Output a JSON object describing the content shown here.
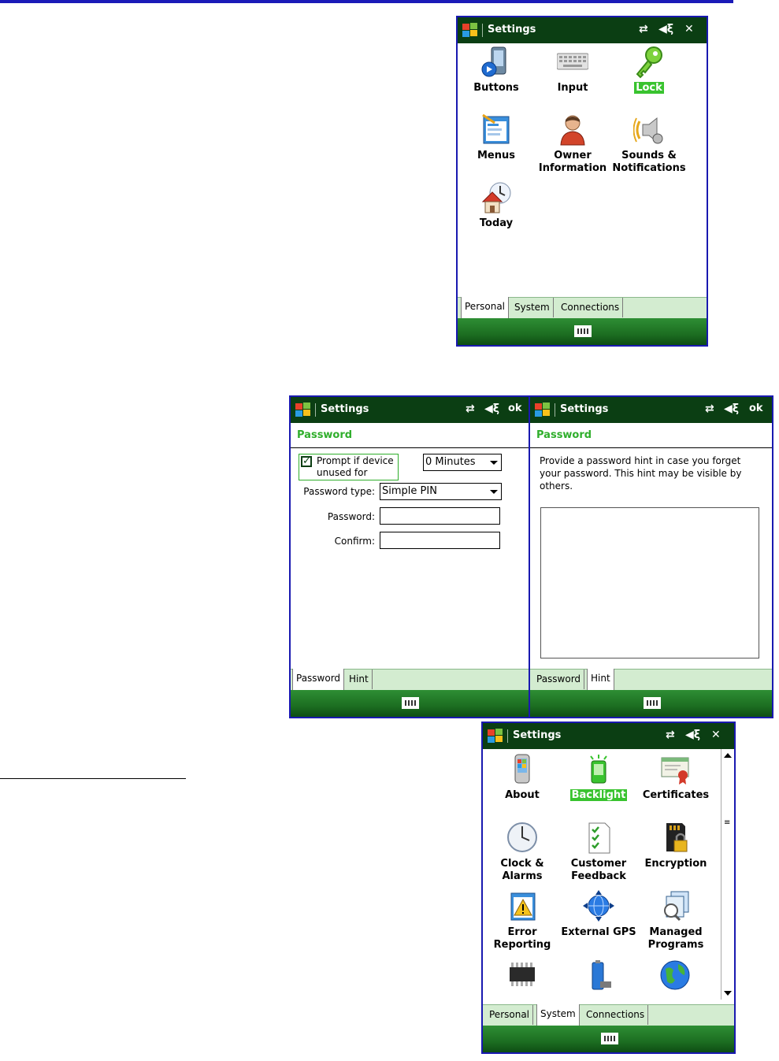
{
  "screen1": {
    "title": "Settings",
    "close_glyph": "✕",
    "icons": [
      {
        "label": "Buttons",
        "icon": "buttons-icon"
      },
      {
        "label": "Input",
        "icon": "keyboard-icon"
      },
      {
        "label": "Lock",
        "icon": "key-icon",
        "highlighted": true
      },
      {
        "label": "Menus",
        "icon": "menus-icon"
      },
      {
        "label": "Owner Information",
        "icon": "owner-icon"
      },
      {
        "label": "Sounds & Notifications",
        "icon": "sounds-icon"
      },
      {
        "label": "Today",
        "icon": "today-icon"
      }
    ],
    "tabs": [
      "Personal",
      "System",
      "Connections"
    ],
    "selected_tab": "Personal"
  },
  "screen2": {
    "title": "Settings",
    "ok_label": "ok",
    "header": "Password",
    "prompt_label": "Prompt if device unused for",
    "prompt_checked": true,
    "minutes_value": "0 Minutes",
    "password_type_label": "Password type:",
    "password_type_value": "Simple PIN",
    "password_label": "Password:",
    "confirm_label": "Confirm:",
    "tabs": [
      "Password",
      "Hint"
    ],
    "selected_tab": "Password"
  },
  "screen3": {
    "title": "Settings",
    "ok_label": "ok",
    "header": "Password",
    "hint_text": "Provide a password hint in case you forget your password.  This hint may be visible by others.",
    "tabs": [
      "Password",
      "Hint"
    ],
    "selected_tab": "Hint"
  },
  "screen4": {
    "title": "Settings",
    "close_glyph": "✕",
    "icons": [
      {
        "label": "About",
        "icon": "phone-icon"
      },
      {
        "label": "Backlight",
        "icon": "backlight-icon",
        "highlighted": true
      },
      {
        "label": "Certificates",
        "icon": "certificate-icon"
      },
      {
        "label": "Clock & Alarms",
        "icon": "clock-icon"
      },
      {
        "label": "Customer Feedback",
        "icon": "feedback-icon"
      },
      {
        "label": "Encryption",
        "icon": "encryption-icon"
      },
      {
        "label": "Error Reporting",
        "icon": "error-icon"
      },
      {
        "label": "External GPS",
        "icon": "gps-icon"
      },
      {
        "label": "Managed Programs",
        "icon": "managed-icon"
      }
    ],
    "tabs": [
      "Personal",
      "System",
      "Connections"
    ],
    "selected_tab": "System"
  },
  "colors": {
    "title_bar": "#0b3e13",
    "accent_green": "#39c32f",
    "tab_bg": "#d3ecd0",
    "frame_blue": "#1919b0"
  }
}
